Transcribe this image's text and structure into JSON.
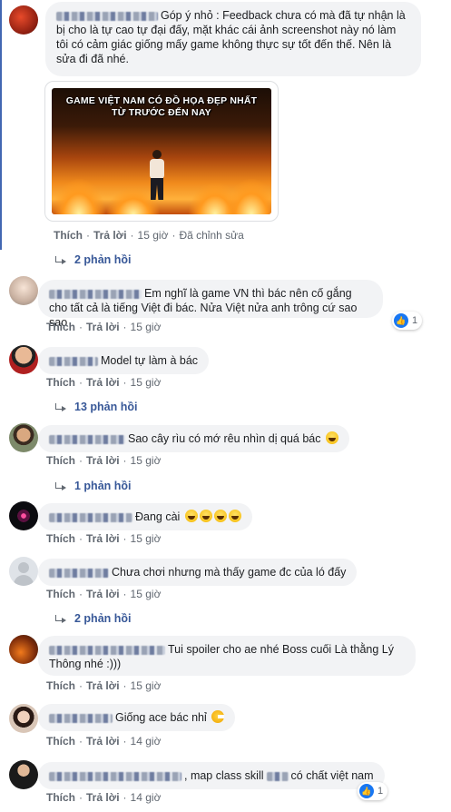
{
  "comments": [
    {
      "text": "Góp ý nhỏ : Feedback chưa có mà đã tự nhận là bị cho là tự cao tự đại đấy, mặt khác cái ảnh screenshot này nó làm tôi có cảm giác giống mấy game không thực sự tốt đến thế. Nên là sửa đi đã nhé.",
      "media_caption_1": "GAME VIỆT NAM CÓ ĐỒ HỌA ĐẸP NHẤT",
      "media_caption_2": "TỪ TRƯỚC ĐẾN NAY",
      "like": "Thích",
      "reply": "Trả lời",
      "time": "15 giờ",
      "edited": "Đã chỉnh sửa",
      "replies": "2 phản hồi"
    },
    {
      "text": "Em nghĩ là game VN thì bác nên cố gắng cho tất cả là tiếng Việt đi bác. Nửa Việt nửa anh trông cứ sao sao",
      "like": "Thích",
      "reply": "Trả lời",
      "time": "15 giờ",
      "reaction_count": "1"
    },
    {
      "text": "Model tự làm à bác",
      "like": "Thích",
      "reply": "Trả lời",
      "time": "15 giờ",
      "replies": "13 phản hồi"
    },
    {
      "text": "Sao cây rìu có mớ rêu nhìn dị quá bác",
      "like": "Thích",
      "reply": "Trả lời",
      "time": "15 giờ",
      "replies": "1 phản hồi"
    },
    {
      "text": "Đang cài",
      "like": "Thích",
      "reply": "Trả lời",
      "time": "15 giờ"
    },
    {
      "text": "Chưa chơi nhưng mà thấy game đc của ló đấy",
      "like": "Thích",
      "reply": "Trả lời",
      "time": "15 giờ",
      "replies": "2 phản hồi"
    },
    {
      "text": "Tui spoiler cho ae nhé Boss cuối Là thằng Lý Thông nhé :)))",
      "like": "Thích",
      "reply": "Trả lời",
      "time": "15 giờ"
    },
    {
      "text": "Giống ace bác nhỉ",
      "like": "Thích",
      "reply": "Trả lời",
      "time": "14 giờ"
    },
    {
      "text": ", map class skill",
      "text_2": "có chất việt nam",
      "like": "Thích",
      "reply": "Trả lời",
      "time": "14 giờ",
      "reaction_count": "1"
    }
  ],
  "icons": {
    "like_reaction": "like-thumb-icon",
    "replies_arrow": "reply-arrow-icon",
    "emoji_laugh": "grinning-emoji-icon",
    "emoji_tongue": "tongue-emoji-icon",
    "emoji_pacman": "pacman-emoji-icon"
  },
  "colors": {
    "link": "#385898",
    "meta": "#606770",
    "bubble": "#f2f3f5",
    "like_blue": "#1877f2",
    "thread_bar": "#4267b2"
  }
}
